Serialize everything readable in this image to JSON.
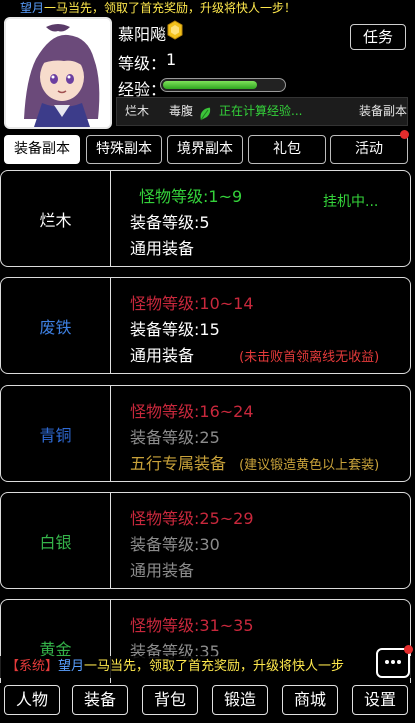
{
  "top_marquee": {
    "name": "望月",
    "message": "一马当先，领取了首充奖励，升级将快人一步！"
  },
  "player": {
    "name": "慕阳飚",
    "level_label": "等级：",
    "level": "1",
    "exp_label": "经验：",
    "exp_progress": 0.78
  },
  "task_button": "任务",
  "status": {
    "item1": "烂木",
    "item2": "毒腹",
    "computing": "正在计算经验...",
    "item4": "装备副本"
  },
  "tabs": [
    "装备副本",
    "特殊副本",
    "境界副本",
    "礼包",
    "活动"
  ],
  "dungeons": [
    {
      "name": "烂木",
      "monster_level": "怪物等级:1~9",
      "equip_level": "装备等级:5",
      "equip_type": "通用装备",
      "status": "挂机中...",
      "note": ""
    },
    {
      "name": "废铁",
      "monster_level": "怪物等级:10~14",
      "equip_level": "装备等级:15",
      "equip_type": "通用装备",
      "status": "",
      "note": "(未击败首领离线无收益)"
    },
    {
      "name": "青铜",
      "monster_level": "怪物等级:16~24",
      "equip_level": "装备等级:25",
      "equip_type": "五行专属装备",
      "status": "",
      "note": "(建议锻造黄色以上套装)"
    },
    {
      "name": "白银",
      "monster_level": "怪物等级:25~29",
      "equip_level": "装备等级:30",
      "equip_type": "通用装备",
      "status": "",
      "note": ""
    },
    {
      "name": "黄金",
      "monster_level": "怪物等级:31~35",
      "equip_level": "装备等级:35",
      "equip_type": "",
      "status": "",
      "note": ""
    }
  ],
  "chat": {
    "prefix": "【系统】",
    "name": "望月",
    "message": "一马当先，领取了首充奖励，升级将快人一步"
  },
  "bottom_nav": [
    "人物",
    "装备",
    "背包",
    "锻造",
    "商城",
    "设置"
  ],
  "colors": {
    "accent_green": "#34d23a",
    "monster_active": "#34d23a",
    "monster_locked": "#c8283c",
    "locked_text": "#8c8c8c",
    "special_equip": "#c9a23a",
    "notice_red": "#e43a3a",
    "tier_lanmu": "#ffffff",
    "tier_feitie": "#3d7fe0",
    "tier_qingtong": "#2f6bd6",
    "tier_baiyin": "#35b34a",
    "tier_huangjin": "#34b249"
  }
}
